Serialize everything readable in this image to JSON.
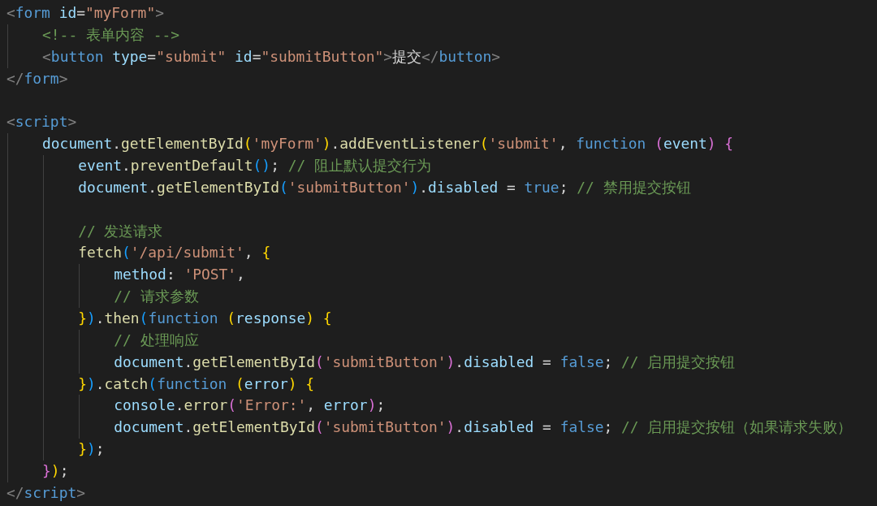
{
  "editor": {
    "lines": [
      {
        "kind": "code",
        "tokens": [
          {
            "kind": "br",
            "text": "<"
          },
          {
            "kind": "tag",
            "text": "form"
          },
          {
            "kind": "attr",
            "text": " id"
          },
          {
            "kind": "p",
            "text": "="
          },
          {
            "kind": "str",
            "text": "\"myForm\""
          },
          {
            "kind": "br",
            "text": ">"
          }
        ],
        "children": [
          {
            "kind": "code",
            "tokens": [
              {
                "kind": "com",
                "text": "<!-- 表单内容 -->"
              }
            ]
          },
          {
            "kind": "code",
            "tokens": [
              {
                "kind": "br",
                "text": "<"
              },
              {
                "kind": "tag",
                "text": "button"
              },
              {
                "kind": "attr",
                "text": " type"
              },
              {
                "kind": "p",
                "text": "="
              },
              {
                "kind": "str",
                "text": "\"submit\""
              },
              {
                "kind": "attr",
                "text": " id"
              },
              {
                "kind": "p",
                "text": "="
              },
              {
                "kind": "str",
                "text": "\"submitButton\""
              },
              {
                "kind": "br",
                "text": ">"
              },
              {
                "kind": "p",
                "text": "提交"
              },
              {
                "kind": "br",
                "text": "</"
              },
              {
                "kind": "tag",
                "text": "button"
              },
              {
                "kind": "br",
                "text": ">"
              }
            ]
          }
        ]
      },
      {
        "kind": "code",
        "tokens": [
          {
            "kind": "br",
            "text": "</"
          },
          {
            "kind": "tag",
            "text": "form"
          },
          {
            "kind": "br",
            "text": ">"
          }
        ]
      },
      {
        "kind": "blank"
      },
      {
        "kind": "code",
        "tokens": [
          {
            "kind": "br",
            "text": "<"
          },
          {
            "kind": "tag",
            "text": "script"
          },
          {
            "kind": "br",
            "text": ">"
          }
        ],
        "children": [
          {
            "kind": "code",
            "tokens": [
              {
                "kind": "var",
                "text": "document"
              },
              {
                "kind": "p",
                "text": "."
              },
              {
                "kind": "fn",
                "text": "getElementById"
              },
              {
                "kind": "b1",
                "text": "("
              },
              {
                "kind": "str",
                "text": "'myForm'"
              },
              {
                "kind": "b1",
                "text": ")"
              },
              {
                "kind": "p",
                "text": "."
              },
              {
                "kind": "fn",
                "text": "addEventListener"
              },
              {
                "kind": "b1",
                "text": "("
              },
              {
                "kind": "str",
                "text": "'submit'"
              },
              {
                "kind": "p",
                "text": ", "
              },
              {
                "kind": "kw",
                "text": "function"
              },
              {
                "kind": "b2",
                "text": " ("
              },
              {
                "kind": "var",
                "text": "event"
              },
              {
                "kind": "b2",
                "text": ")"
              },
              {
                "kind": "b2",
                "text": " {"
              }
            ],
            "children": [
              {
                "kind": "code",
                "tokens": [
                  {
                    "kind": "var",
                    "text": "event"
                  },
                  {
                    "kind": "p",
                    "text": "."
                  },
                  {
                    "kind": "fn",
                    "text": "preventDefault"
                  },
                  {
                    "kind": "b3",
                    "text": "()"
                  },
                  {
                    "kind": "p",
                    "text": "; "
                  },
                  {
                    "kind": "com",
                    "text": "// 阻止默认提交行为"
                  }
                ]
              },
              {
                "kind": "code",
                "tokens": [
                  {
                    "kind": "var",
                    "text": "document"
                  },
                  {
                    "kind": "p",
                    "text": "."
                  },
                  {
                    "kind": "fn",
                    "text": "getElementById"
                  },
                  {
                    "kind": "b3",
                    "text": "("
                  },
                  {
                    "kind": "str",
                    "text": "'submitButton'"
                  },
                  {
                    "kind": "b3",
                    "text": ")"
                  },
                  {
                    "kind": "p",
                    "text": "."
                  },
                  {
                    "kind": "var",
                    "text": "disabled"
                  },
                  {
                    "kind": "p",
                    "text": " = "
                  },
                  {
                    "kind": "kw",
                    "text": "true"
                  },
                  {
                    "kind": "p",
                    "text": "; "
                  },
                  {
                    "kind": "com",
                    "text": "// 禁用提交按钮"
                  }
                ]
              },
              {
                "kind": "blank"
              },
              {
                "kind": "code",
                "tokens": [
                  {
                    "kind": "com",
                    "text": "// 发送请求"
                  }
                ]
              },
              {
                "kind": "code",
                "tokens": [
                  {
                    "kind": "fn",
                    "text": "fetch"
                  },
                  {
                    "kind": "b3",
                    "text": "("
                  },
                  {
                    "kind": "str",
                    "text": "'/api/submit'"
                  },
                  {
                    "kind": "p",
                    "text": ", "
                  },
                  {
                    "kind": "b1",
                    "text": "{"
                  }
                ],
                "children": [
                  {
                    "kind": "code",
                    "tokens": [
                      {
                        "kind": "var",
                        "text": "method"
                      },
                      {
                        "kind": "p",
                        "text": ": "
                      },
                      {
                        "kind": "str",
                        "text": "'POST'"
                      },
                      {
                        "kind": "p",
                        "text": ","
                      }
                    ]
                  },
                  {
                    "kind": "code",
                    "tokens": [
                      {
                        "kind": "com",
                        "text": "// 请求参数"
                      }
                    ]
                  }
                ]
              },
              {
                "kind": "code",
                "tokens": [
                  {
                    "kind": "b1",
                    "text": "}"
                  },
                  {
                    "kind": "b3",
                    "text": ")"
                  },
                  {
                    "kind": "p",
                    "text": "."
                  },
                  {
                    "kind": "fn",
                    "text": "then"
                  },
                  {
                    "kind": "b3",
                    "text": "("
                  },
                  {
                    "kind": "kw",
                    "text": "function"
                  },
                  {
                    "kind": "b1",
                    "text": " ("
                  },
                  {
                    "kind": "var",
                    "text": "response"
                  },
                  {
                    "kind": "b1",
                    "text": ")"
                  },
                  {
                    "kind": "b1",
                    "text": " {"
                  }
                ],
                "children": [
                  {
                    "kind": "code",
                    "tokens": [
                      {
                        "kind": "com",
                        "text": "// 处理响应"
                      }
                    ]
                  },
                  {
                    "kind": "code",
                    "tokens": [
                      {
                        "kind": "var",
                        "text": "document"
                      },
                      {
                        "kind": "p",
                        "text": "."
                      },
                      {
                        "kind": "fn",
                        "text": "getElementById"
                      },
                      {
                        "kind": "b2",
                        "text": "("
                      },
                      {
                        "kind": "str",
                        "text": "'submitButton'"
                      },
                      {
                        "kind": "b2",
                        "text": ")"
                      },
                      {
                        "kind": "p",
                        "text": "."
                      },
                      {
                        "kind": "var",
                        "text": "disabled"
                      },
                      {
                        "kind": "p",
                        "text": " = "
                      },
                      {
                        "kind": "kw",
                        "text": "false"
                      },
                      {
                        "kind": "p",
                        "text": "; "
                      },
                      {
                        "kind": "com",
                        "text": "// 启用提交按钮"
                      }
                    ]
                  }
                ]
              },
              {
                "kind": "code",
                "tokens": [
                  {
                    "kind": "b1",
                    "text": "}"
                  },
                  {
                    "kind": "b3",
                    "text": ")"
                  },
                  {
                    "kind": "p",
                    "text": "."
                  },
                  {
                    "kind": "fn",
                    "text": "catch"
                  },
                  {
                    "kind": "b3",
                    "text": "("
                  },
                  {
                    "kind": "kw",
                    "text": "function"
                  },
                  {
                    "kind": "b1",
                    "text": " ("
                  },
                  {
                    "kind": "var",
                    "text": "error"
                  },
                  {
                    "kind": "b1",
                    "text": ")"
                  },
                  {
                    "kind": "b1",
                    "text": " {"
                  }
                ],
                "children": [
                  {
                    "kind": "code",
                    "tokens": [
                      {
                        "kind": "var",
                        "text": "console"
                      },
                      {
                        "kind": "p",
                        "text": "."
                      },
                      {
                        "kind": "fn",
                        "text": "error"
                      },
                      {
                        "kind": "b2",
                        "text": "("
                      },
                      {
                        "kind": "str",
                        "text": "'Error:'"
                      },
                      {
                        "kind": "p",
                        "text": ", "
                      },
                      {
                        "kind": "var",
                        "text": "error"
                      },
                      {
                        "kind": "b2",
                        "text": ")"
                      },
                      {
                        "kind": "p",
                        "text": ";"
                      }
                    ]
                  },
                  {
                    "kind": "code",
                    "tokens": [
                      {
                        "kind": "var",
                        "text": "document"
                      },
                      {
                        "kind": "p",
                        "text": "."
                      },
                      {
                        "kind": "fn",
                        "text": "getElementById"
                      },
                      {
                        "kind": "b2",
                        "text": "("
                      },
                      {
                        "kind": "str",
                        "text": "'submitButton'"
                      },
                      {
                        "kind": "b2",
                        "text": ")"
                      },
                      {
                        "kind": "p",
                        "text": "."
                      },
                      {
                        "kind": "var",
                        "text": "disabled"
                      },
                      {
                        "kind": "p",
                        "text": " = "
                      },
                      {
                        "kind": "kw",
                        "text": "false"
                      },
                      {
                        "kind": "p",
                        "text": "; "
                      },
                      {
                        "kind": "com",
                        "text": "// 启用提交按钮（如果请求失败）"
                      }
                    ]
                  }
                ]
              },
              {
                "kind": "code",
                "tokens": [
                  {
                    "kind": "b1",
                    "text": "}"
                  },
                  {
                    "kind": "b3",
                    "text": ")"
                  },
                  {
                    "kind": "p",
                    "text": ";"
                  }
                ]
              }
            ]
          },
          {
            "kind": "code",
            "tokens": [
              {
                "kind": "b2",
                "text": "}"
              },
              {
                "kind": "b1",
                "text": ")"
              },
              {
                "kind": "p",
                "text": ";"
              }
            ]
          }
        ]
      },
      {
        "kind": "code",
        "tokens": [
          {
            "kind": "br",
            "text": "</"
          },
          {
            "kind": "tag",
            "text": "script"
          },
          {
            "kind": "br",
            "text": ">"
          }
        ]
      }
    ]
  }
}
